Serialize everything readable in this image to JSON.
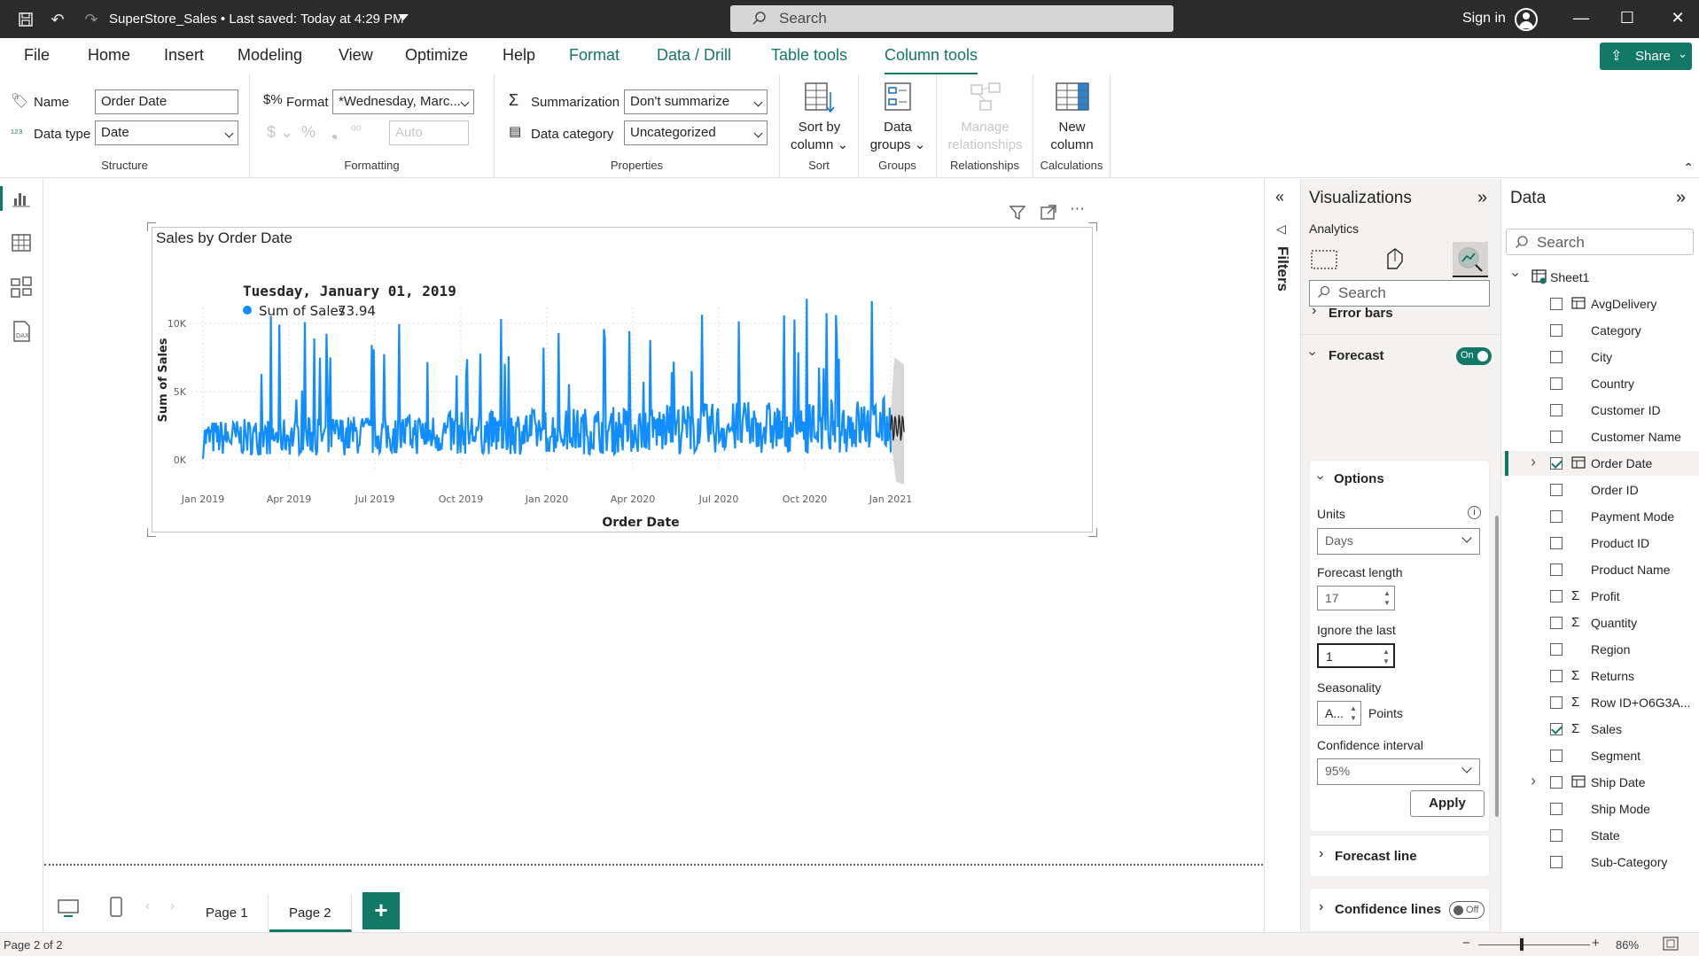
{
  "titlebar": {
    "file_title": "SuperStore_Sales  •  Last saved: Today at 4:29 PM",
    "search_placeholder": "Search",
    "sign_in": "Sign in"
  },
  "menu": {
    "tabs": [
      "File",
      "Home",
      "Insert",
      "Modeling",
      "View",
      "Optimize",
      "Help",
      "Format",
      "Data / Drill",
      "Table tools",
      "Column tools"
    ],
    "active": "Column tools",
    "share": "Share"
  },
  "ribbon": {
    "structure": {
      "name_label": "Name",
      "name_value": "Order Date",
      "datatype_label": "Data type",
      "datatype_value": "Date",
      "group": "Structure"
    },
    "formatting": {
      "format_label": "Format",
      "format_value": "*Wednesday, Marc...",
      "decimal_value": "Auto",
      "group": "Formatting"
    },
    "properties": {
      "summarization_label": "Summarization",
      "summarization_value": "Don't summarize",
      "category_label": "Data category",
      "category_value": "Uncategorized",
      "group": "Properties"
    },
    "sort": {
      "button": "Sort by column",
      "line1": "Sort by",
      "line2": "column",
      "group": "Sort"
    },
    "groups": {
      "line1": "Data",
      "line2": "groups",
      "group": "Groups"
    },
    "relationships": {
      "line1": "Manage",
      "line2": "relationships",
      "group": "Relationships"
    },
    "calculations": {
      "line1": "New",
      "line2": "column",
      "group": "Calculations"
    }
  },
  "visual": {
    "title": "Sales by Order Date",
    "tooltip_date": "Tuesday, January 01, 2019",
    "tooltip_series": "Sum of Sales",
    "tooltip_value": "73.94"
  },
  "chart_data": {
    "type": "line",
    "title": "Sales by Order Date",
    "xlabel": "Order Date",
    "ylabel": "Sum of Sales",
    "y_ticks": [
      "0K",
      "5K",
      "10K"
    ],
    "x_ticks": [
      "Jan 2019",
      "Apr 2019",
      "Jul 2019",
      "Oct 2019",
      "Jan 2020",
      "Apr 2020",
      "Jul 2020",
      "Oct 2020",
      "Jan 2021"
    ],
    "ylim": [
      0,
      12000
    ],
    "series": [
      {
        "name": "Sum of Sales",
        "color": "#118DFF",
        "x_range": [
          "2019-01-01",
          "2020-12-31"
        ],
        "approx_peak": 11800,
        "typical_range": [
          500,
          4500
        ]
      },
      {
        "name": "Forecast",
        "color": "#252423",
        "x_range": [
          "2021-01-01",
          "2021-01-17"
        ],
        "confidence_interval": "95%"
      }
    ],
    "grid": true
  },
  "pages": {
    "tabs": [
      "Page 1",
      "Page 2"
    ],
    "active": "Page 2"
  },
  "status": {
    "page_info": "Page 2 of 2",
    "zoom": "86%"
  },
  "filters": {
    "label": "Filters"
  },
  "viz": {
    "title": "Visualizations",
    "subtitle": "Analytics",
    "search_placeholder": "Search",
    "error_bars": "Error bars",
    "forecast": "Forecast",
    "forecast_toggle": "On",
    "options": "Options",
    "units_label": "Units",
    "units_value": "Days",
    "forecast_length_label": "Forecast length",
    "forecast_length_value": "17",
    "ignore_last_label": "Ignore the last",
    "ignore_last_value": "1",
    "seasonality_label": "Seasonality",
    "seasonality_value": "A...",
    "seasonality_unit": "Points",
    "confidence_label": "Confidence interval",
    "confidence_value": "95%",
    "apply": "Apply",
    "forecast_line": "Forecast line",
    "confidence_lines": "Confidence lines",
    "confidence_toggle": "Off"
  },
  "data_pane": {
    "title": "Data",
    "search_placeholder": "Search",
    "table": "Sheet1",
    "fields": [
      {
        "name": "AvgDelivery",
        "icon": "calc",
        "checked": false
      },
      {
        "name": "Category",
        "icon": "",
        "checked": false
      },
      {
        "name": "City",
        "icon": "",
        "checked": false
      },
      {
        "name": "Country",
        "icon": "",
        "checked": false
      },
      {
        "name": "Customer ID",
        "icon": "",
        "checked": false
      },
      {
        "name": "Customer Name",
        "icon": "",
        "checked": false
      },
      {
        "name": "Order Date",
        "icon": "date",
        "checked": true,
        "expandable": true,
        "selected": true
      },
      {
        "name": "Order ID",
        "icon": "",
        "checked": false
      },
      {
        "name": "Payment Mode",
        "icon": "",
        "checked": false
      },
      {
        "name": "Product ID",
        "icon": "",
        "checked": false
      },
      {
        "name": "Product Name",
        "icon": "",
        "checked": false
      },
      {
        "name": "Profit",
        "icon": "sigma",
        "checked": false
      },
      {
        "name": "Quantity",
        "icon": "sigma",
        "checked": false
      },
      {
        "name": "Region",
        "icon": "",
        "checked": false
      },
      {
        "name": "Returns",
        "icon": "sigma",
        "checked": false
      },
      {
        "name": "Row ID+O6G3A...",
        "icon": "sigma",
        "checked": false
      },
      {
        "name": "Sales",
        "icon": "sigma",
        "checked": true
      },
      {
        "name": "Segment",
        "icon": "",
        "checked": false
      },
      {
        "name": "Ship Date",
        "icon": "date",
        "checked": false,
        "expandable": true
      },
      {
        "name": "Ship Mode",
        "icon": "",
        "checked": false
      },
      {
        "name": "State",
        "icon": "",
        "checked": false
      },
      {
        "name": "Sub-Category",
        "icon": "",
        "checked": false
      }
    ]
  },
  "colors": {
    "accent": "#117865",
    "series": "#118DFF"
  }
}
